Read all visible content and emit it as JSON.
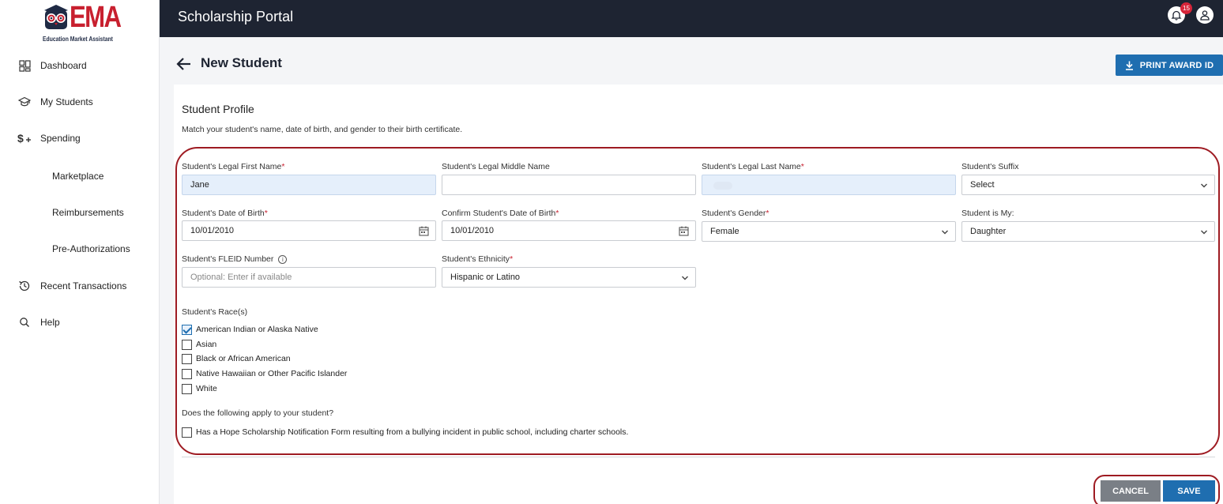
{
  "app": {
    "logo_text": "EMA",
    "logo_tagline": "Education Market Assistant",
    "portal_title": "Scholarship Portal",
    "notification_count": "15"
  },
  "sidebar": {
    "items": [
      {
        "label": "Dashboard",
        "icon": "dashboard-grid-icon"
      },
      {
        "label": "My Students",
        "icon": "graduation-cap-icon"
      },
      {
        "label": "Spending",
        "icon": "dollar-plus-icon"
      },
      {
        "label": "Marketplace",
        "icon": ""
      },
      {
        "label": "Reimbursements",
        "icon": ""
      },
      {
        "label": "Pre-Authorizations",
        "icon": ""
      },
      {
        "label": "Recent Transactions",
        "icon": "history-clock-icon"
      },
      {
        "label": "Help",
        "icon": "search-icon"
      }
    ]
  },
  "header": {
    "page_title": "New Student",
    "print_button_label": "PRINT AWARD ID"
  },
  "profile": {
    "section_title": "Student Profile",
    "section_desc": "Match your student's name, date of birth, and gender to their birth certificate.",
    "first_name": {
      "label": "Student's Legal First Name",
      "required": "*",
      "value": "Jane"
    },
    "middle_name": {
      "label": "Student's Legal Middle Name",
      "value": ""
    },
    "last_name": {
      "label": "Student's Legal Last Name",
      "required": "*",
      "value": ""
    },
    "suffix": {
      "label": "Student's Suffix",
      "value": "Select"
    },
    "dob": {
      "label": "Student's Date of Birth",
      "required": "*",
      "value": "10/01/2010"
    },
    "confirm_dob": {
      "label": "Confirm Student's Date of Birth",
      "required": "*",
      "value": "10/01/2010"
    },
    "gender": {
      "label": "Student's Gender",
      "required": "*",
      "value": "Female"
    },
    "relation": {
      "label": "Student is My:",
      "value": "Daughter"
    },
    "fleid": {
      "label": "Student's FLEID Number",
      "placeholder": "Optional: Enter if available",
      "info_glyph": "i"
    },
    "ethnicity": {
      "label": "Student's Ethnicity",
      "required": "*",
      "value": "Hispanic or Latino"
    },
    "race_label": "Student's Race(s)",
    "races": [
      {
        "label": "American Indian or Alaska Native",
        "checked": true
      },
      {
        "label": "Asian",
        "checked": false
      },
      {
        "label": "Black or African American",
        "checked": false
      },
      {
        "label": "Native Hawaiian or Other Pacific Islander",
        "checked": false
      },
      {
        "label": "White",
        "checked": false
      }
    ],
    "apply_question": "Does the following apply to your student?",
    "hope_option": {
      "label": "Has a Hope Scholarship Notification Form resulting from a bullying incident in public school, including charter schools.",
      "checked": false
    }
  },
  "footer": {
    "cancel_label": "CANCEL",
    "save_label": "SAVE"
  },
  "colors": {
    "topbar": "#1e2432",
    "primary": "#1f6eb0",
    "brand_red": "#c8202f",
    "annotation_outline": "#9e1b22",
    "cancel": "#7a7f86"
  }
}
